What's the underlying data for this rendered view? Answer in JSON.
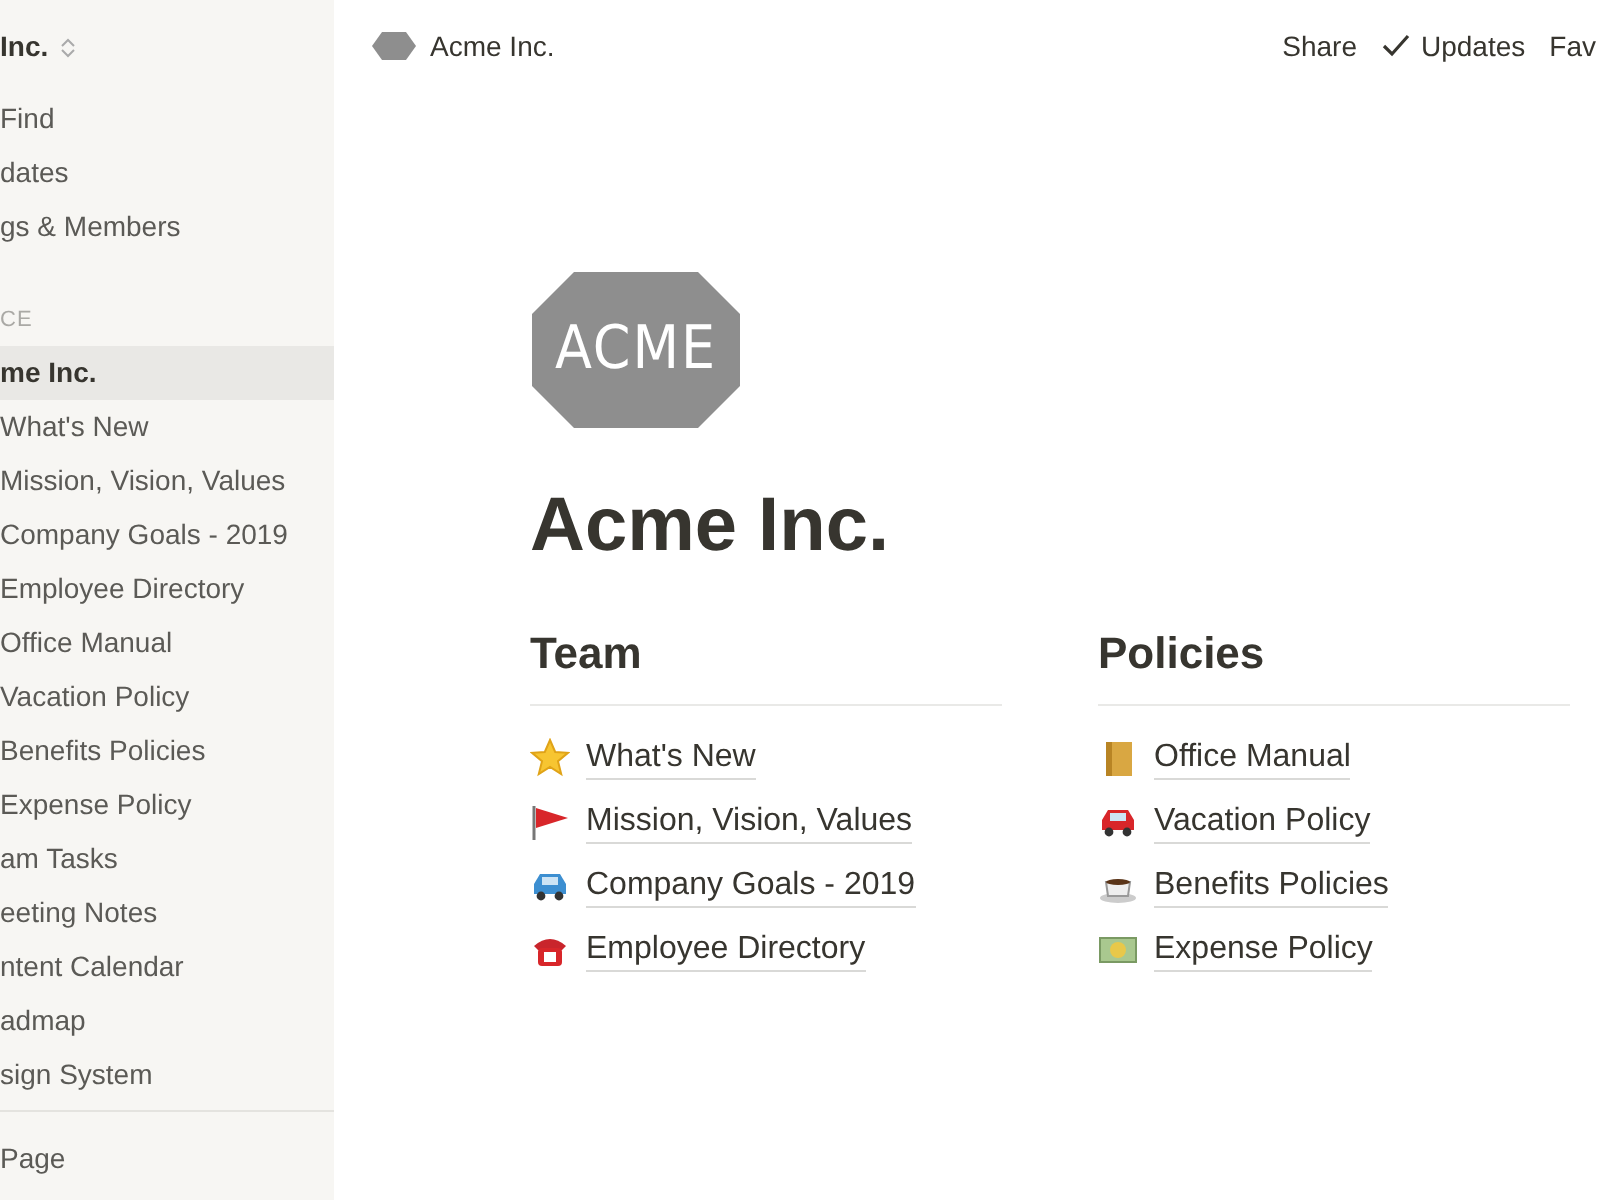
{
  "sidebar": {
    "workspace": "Inc.",
    "top_items": [
      "Find",
      "dates",
      "gs & Members"
    ],
    "section_label": "CE",
    "pages": [
      {
        "label": "me Inc.",
        "selected": true
      },
      {
        "label": "What's New",
        "selected": false
      },
      {
        "label": "Mission, Vision, Values",
        "selected": false
      },
      {
        "label": "Company Goals - 2019",
        "selected": false
      },
      {
        "label": "Employee Directory",
        "selected": false
      },
      {
        "label": "Office Manual",
        "selected": false
      },
      {
        "label": "Vacation Policy",
        "selected": false
      },
      {
        "label": "Benefits Policies",
        "selected": false
      },
      {
        "label": "Expense Policy",
        "selected": false
      },
      {
        "label": "am Tasks",
        "selected": false
      },
      {
        "label": "eeting Notes",
        "selected": false
      },
      {
        "label": "ntent Calendar",
        "selected": false
      },
      {
        "label": "admap",
        "selected": false
      },
      {
        "label": "sign System",
        "selected": false
      }
    ],
    "bottom_item": "Page"
  },
  "topbar": {
    "breadcrumb": "Acme Inc.",
    "actions": [
      "Share",
      "Updates",
      "Fav"
    ]
  },
  "logo_text": "ACME",
  "title": "Acme Inc.",
  "columns": [
    {
      "heading": "Team",
      "links": [
        "What's New",
        "Mission, Vision, Values",
        "Company Goals - 2019",
        "Employee Directory"
      ]
    },
    {
      "heading": "Policies",
      "links": [
        "Office Manual",
        "Vacation Policy",
        "Benefits Policies",
        "Expense Policy"
      ]
    }
  ]
}
